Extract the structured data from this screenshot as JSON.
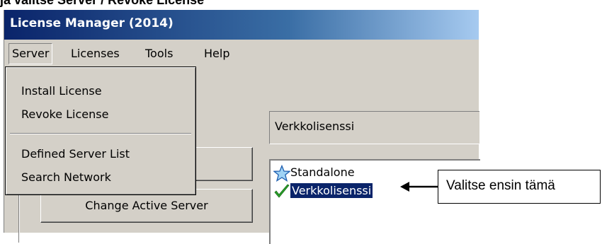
{
  "caption": "ja valitse Server / Revoke License",
  "window": {
    "title": "License Manager (2014)"
  },
  "menubar": {
    "items": [
      "Server",
      "Licenses",
      "Tools",
      "Help"
    ]
  },
  "server_menu": {
    "items": [
      "Install License",
      "Revoke License",
      "Defined Server List",
      "Search Network"
    ]
  },
  "license_field": {
    "value": "Verkkolisenssi"
  },
  "license_list": {
    "items": [
      {
        "label": "Standalone",
        "icon": "star-icon",
        "selected": false
      },
      {
        "label": "Verkkolisenssi",
        "icon": "checkmark-icon",
        "selected": true
      }
    ]
  },
  "buttons": {
    "change_active_server": "Change Active Server"
  },
  "annotation": {
    "label": "Valitse ensin tämä"
  },
  "colors": {
    "titlebar_start": "#0a246a",
    "titlebar_end": "#a6caf0",
    "selection": "#0a246a",
    "window_face": "#d4d0c8"
  }
}
